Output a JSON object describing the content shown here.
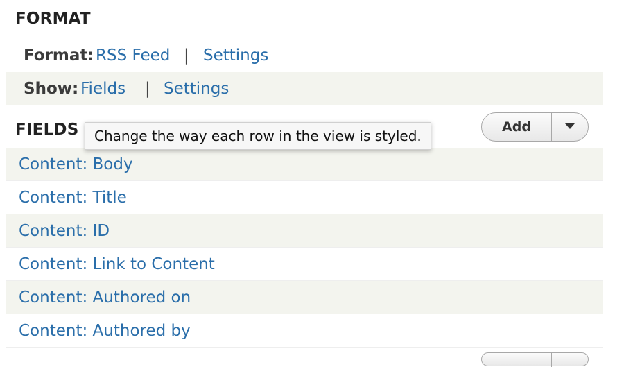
{
  "format_section": {
    "title": "FORMAT",
    "format_row": {
      "label": "Format:",
      "value_link": "RSS Feed",
      "separator": "|",
      "settings_link": "Settings"
    },
    "show_row": {
      "label": "Show:",
      "value_link": "Fields",
      "separator": "|",
      "settings_link": "Settings"
    }
  },
  "fields_section": {
    "title": "FIELDS",
    "add_button": "Add",
    "dropdown_icon": "chevron-down-icon",
    "items": [
      "Content: Body",
      "Content: Title",
      "Content: ID",
      "Content: Link to Content",
      "Content: Authored on",
      "Content: Authored by"
    ]
  },
  "tooltip": {
    "text": "Change the way each row in the view is styled."
  },
  "colors": {
    "link": "#2a6eaa",
    "alt_row": "#f3f4ee",
    "heading": "#222222"
  }
}
